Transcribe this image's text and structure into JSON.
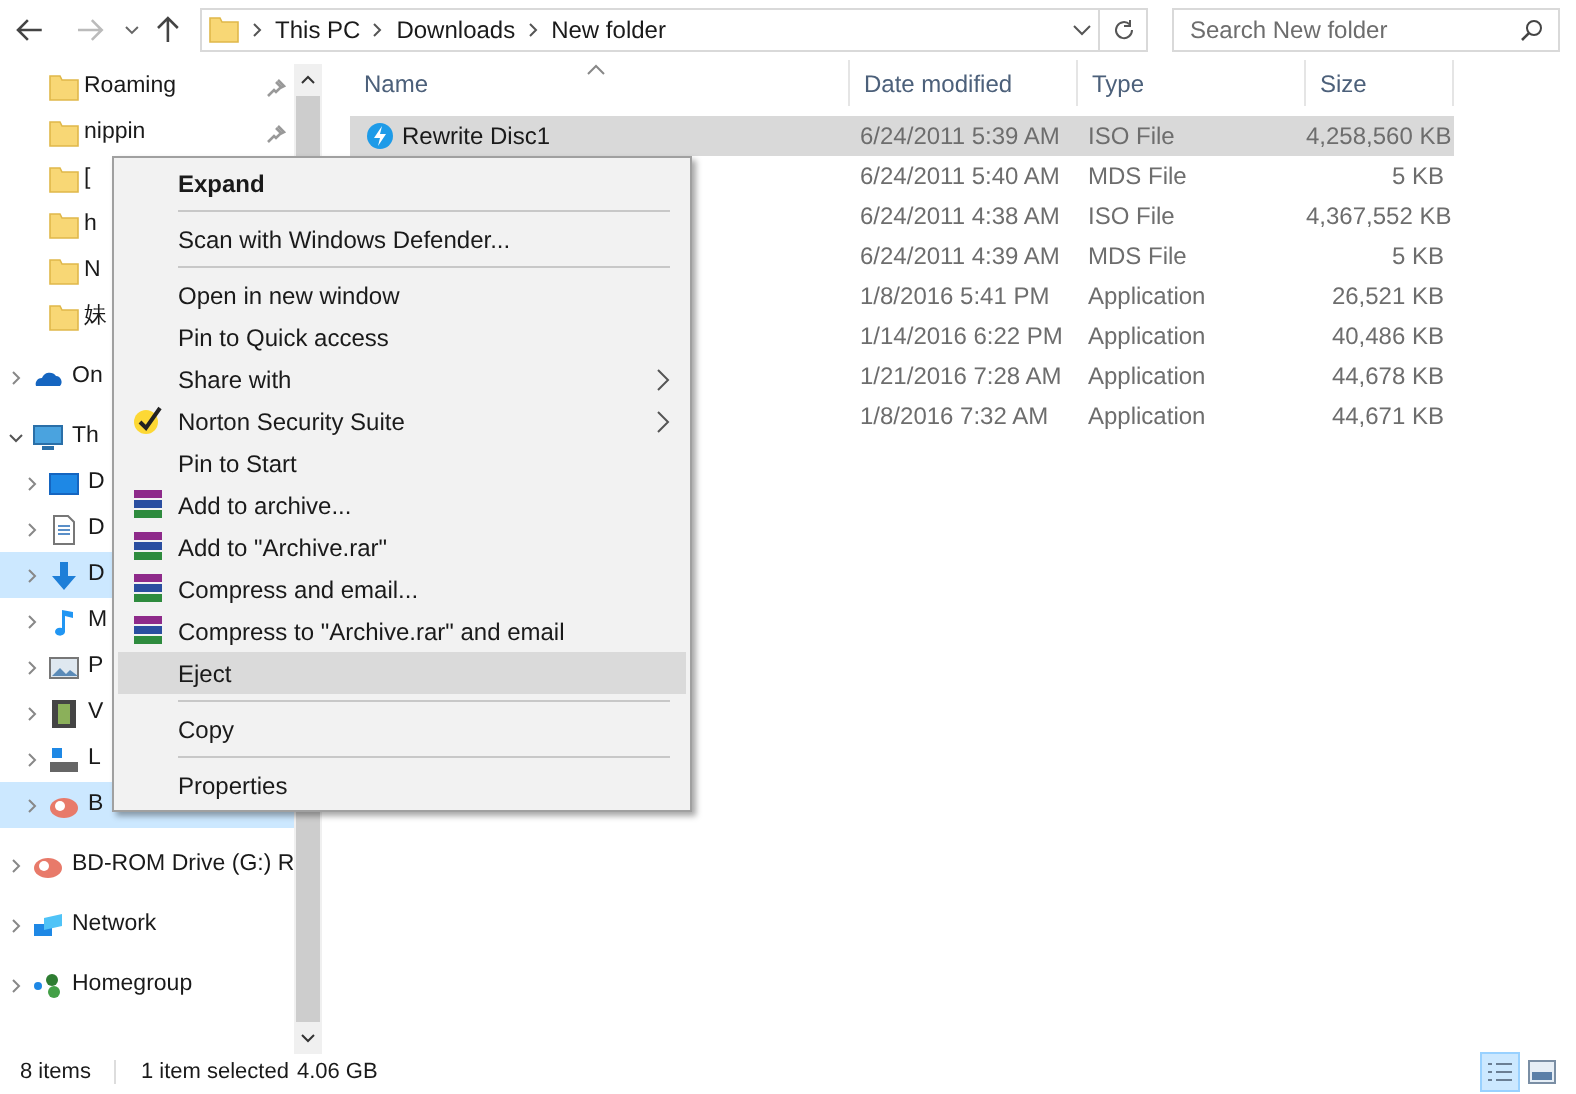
{
  "address_bar": {
    "breadcrumbs": [
      "This PC",
      "Downloads",
      "New folder"
    ]
  },
  "search": {
    "placeholder": "Search New folder"
  },
  "sidebar": {
    "quick_access": [
      {
        "label": "Roaming",
        "pinned": true
      },
      {
        "label": "nippin",
        "pinned": true
      },
      {
        "label": "["
      },
      {
        "label": "h"
      },
      {
        "label": "N"
      },
      {
        "label": "妹"
      }
    ],
    "tree": [
      {
        "label": "On",
        "kind": "cloud",
        "expanded": false,
        "selected": false
      },
      {
        "label": "Th",
        "kind": "pc",
        "expanded": true,
        "selected": false,
        "children": [
          {
            "label": "D",
            "kind": "desktop",
            "expanded": false,
            "selected": false
          },
          {
            "label": "D",
            "kind": "documents",
            "expanded": false,
            "selected": false
          },
          {
            "label": "D",
            "kind": "downloads",
            "expanded": false,
            "selected": true
          },
          {
            "label": "M",
            "kind": "music",
            "expanded": false,
            "selected": false
          },
          {
            "label": "P",
            "kind": "pictures",
            "expanded": false,
            "selected": false
          },
          {
            "label": "V",
            "kind": "videos",
            "expanded": false,
            "selected": false
          },
          {
            "label": "L",
            "kind": "disk",
            "expanded": false,
            "selected": false
          },
          {
            "label": "B",
            "kind": "bd",
            "expanded": false,
            "selected": true
          }
        ]
      },
      {
        "label": "BD-ROM Drive (G:) R",
        "kind": "bd",
        "expanded": false,
        "selected": false
      },
      {
        "label": "Network",
        "kind": "network",
        "expanded": false,
        "selected": false
      },
      {
        "label": "Homegroup",
        "kind": "homegroup",
        "expanded": false,
        "selected": false
      }
    ]
  },
  "table": {
    "columns": [
      "Name",
      "Date modified",
      "Type",
      "Size"
    ],
    "rows": [
      {
        "name": "Rewrite Disc1",
        "date": "6/24/2011 5:39 AM",
        "type": "ISO File",
        "size": "4,258,560 KB",
        "selected": true
      },
      {
        "date": "6/24/2011 5:40 AM",
        "type": "MDS File",
        "size": "5 KB",
        "selected": false
      },
      {
        "date": "6/24/2011 4:38 AM",
        "type": "ISO File",
        "size": "4,367,552 KB",
        "selected": false
      },
      {
        "date": "6/24/2011 4:39 AM",
        "type": "MDS File",
        "size": "5 KB",
        "selected": false
      },
      {
        "date": "1/8/2016 5:41 PM",
        "type": "Application",
        "size": "26,521 KB",
        "selected": false
      },
      {
        "date": "1/14/2016 6:22 PM",
        "type": "Application",
        "size": "40,486 KB",
        "selected": false
      },
      {
        "date": "1/21/2016 7:28 AM",
        "type": "Application",
        "size": "44,678 KB",
        "selected": false
      },
      {
        "date": "1/8/2016 7:32 AM",
        "type": "Application",
        "size": "44,671 KB",
        "selected": false
      }
    ]
  },
  "context_menu": [
    {
      "kind": "item",
      "label": "Expand",
      "bold": true,
      "selected": false
    },
    {
      "kind": "separator"
    },
    {
      "kind": "item",
      "label": "Scan with Windows Defender...",
      "selected": false
    },
    {
      "kind": "separator"
    },
    {
      "kind": "item",
      "label": "Open in new window",
      "selected": false
    },
    {
      "kind": "item",
      "label": "Pin to Quick access",
      "selected": false
    },
    {
      "kind": "item",
      "label": "Share with",
      "submenu": true,
      "selected": false
    },
    {
      "kind": "norton-item",
      "label": "Norton Security Suite",
      "submenu": true,
      "selected": false
    },
    {
      "kind": "item",
      "label": "Pin to Start",
      "selected": false
    },
    {
      "kind": "rar-item",
      "label": "Add to archive...",
      "selected": false
    },
    {
      "kind": "rar-item",
      "label": "Add to \"Archive.rar\"",
      "selected": false
    },
    {
      "kind": "rar-item",
      "label": "Compress and email...",
      "selected": false
    },
    {
      "kind": "rar-item",
      "label": "Compress to \"Archive.rar\" and email",
      "selected": false
    },
    {
      "kind": "item",
      "label": "Eject",
      "selected": true
    },
    {
      "kind": "separator"
    },
    {
      "kind": "item",
      "label": "Copy",
      "selected": false
    },
    {
      "kind": "separator"
    },
    {
      "kind": "item",
      "label": "Properties",
      "selected": false
    }
  ],
  "status_bar": {
    "item_count": "8 items",
    "selection": "1 item selected",
    "selection_size": "4.06 GB"
  }
}
